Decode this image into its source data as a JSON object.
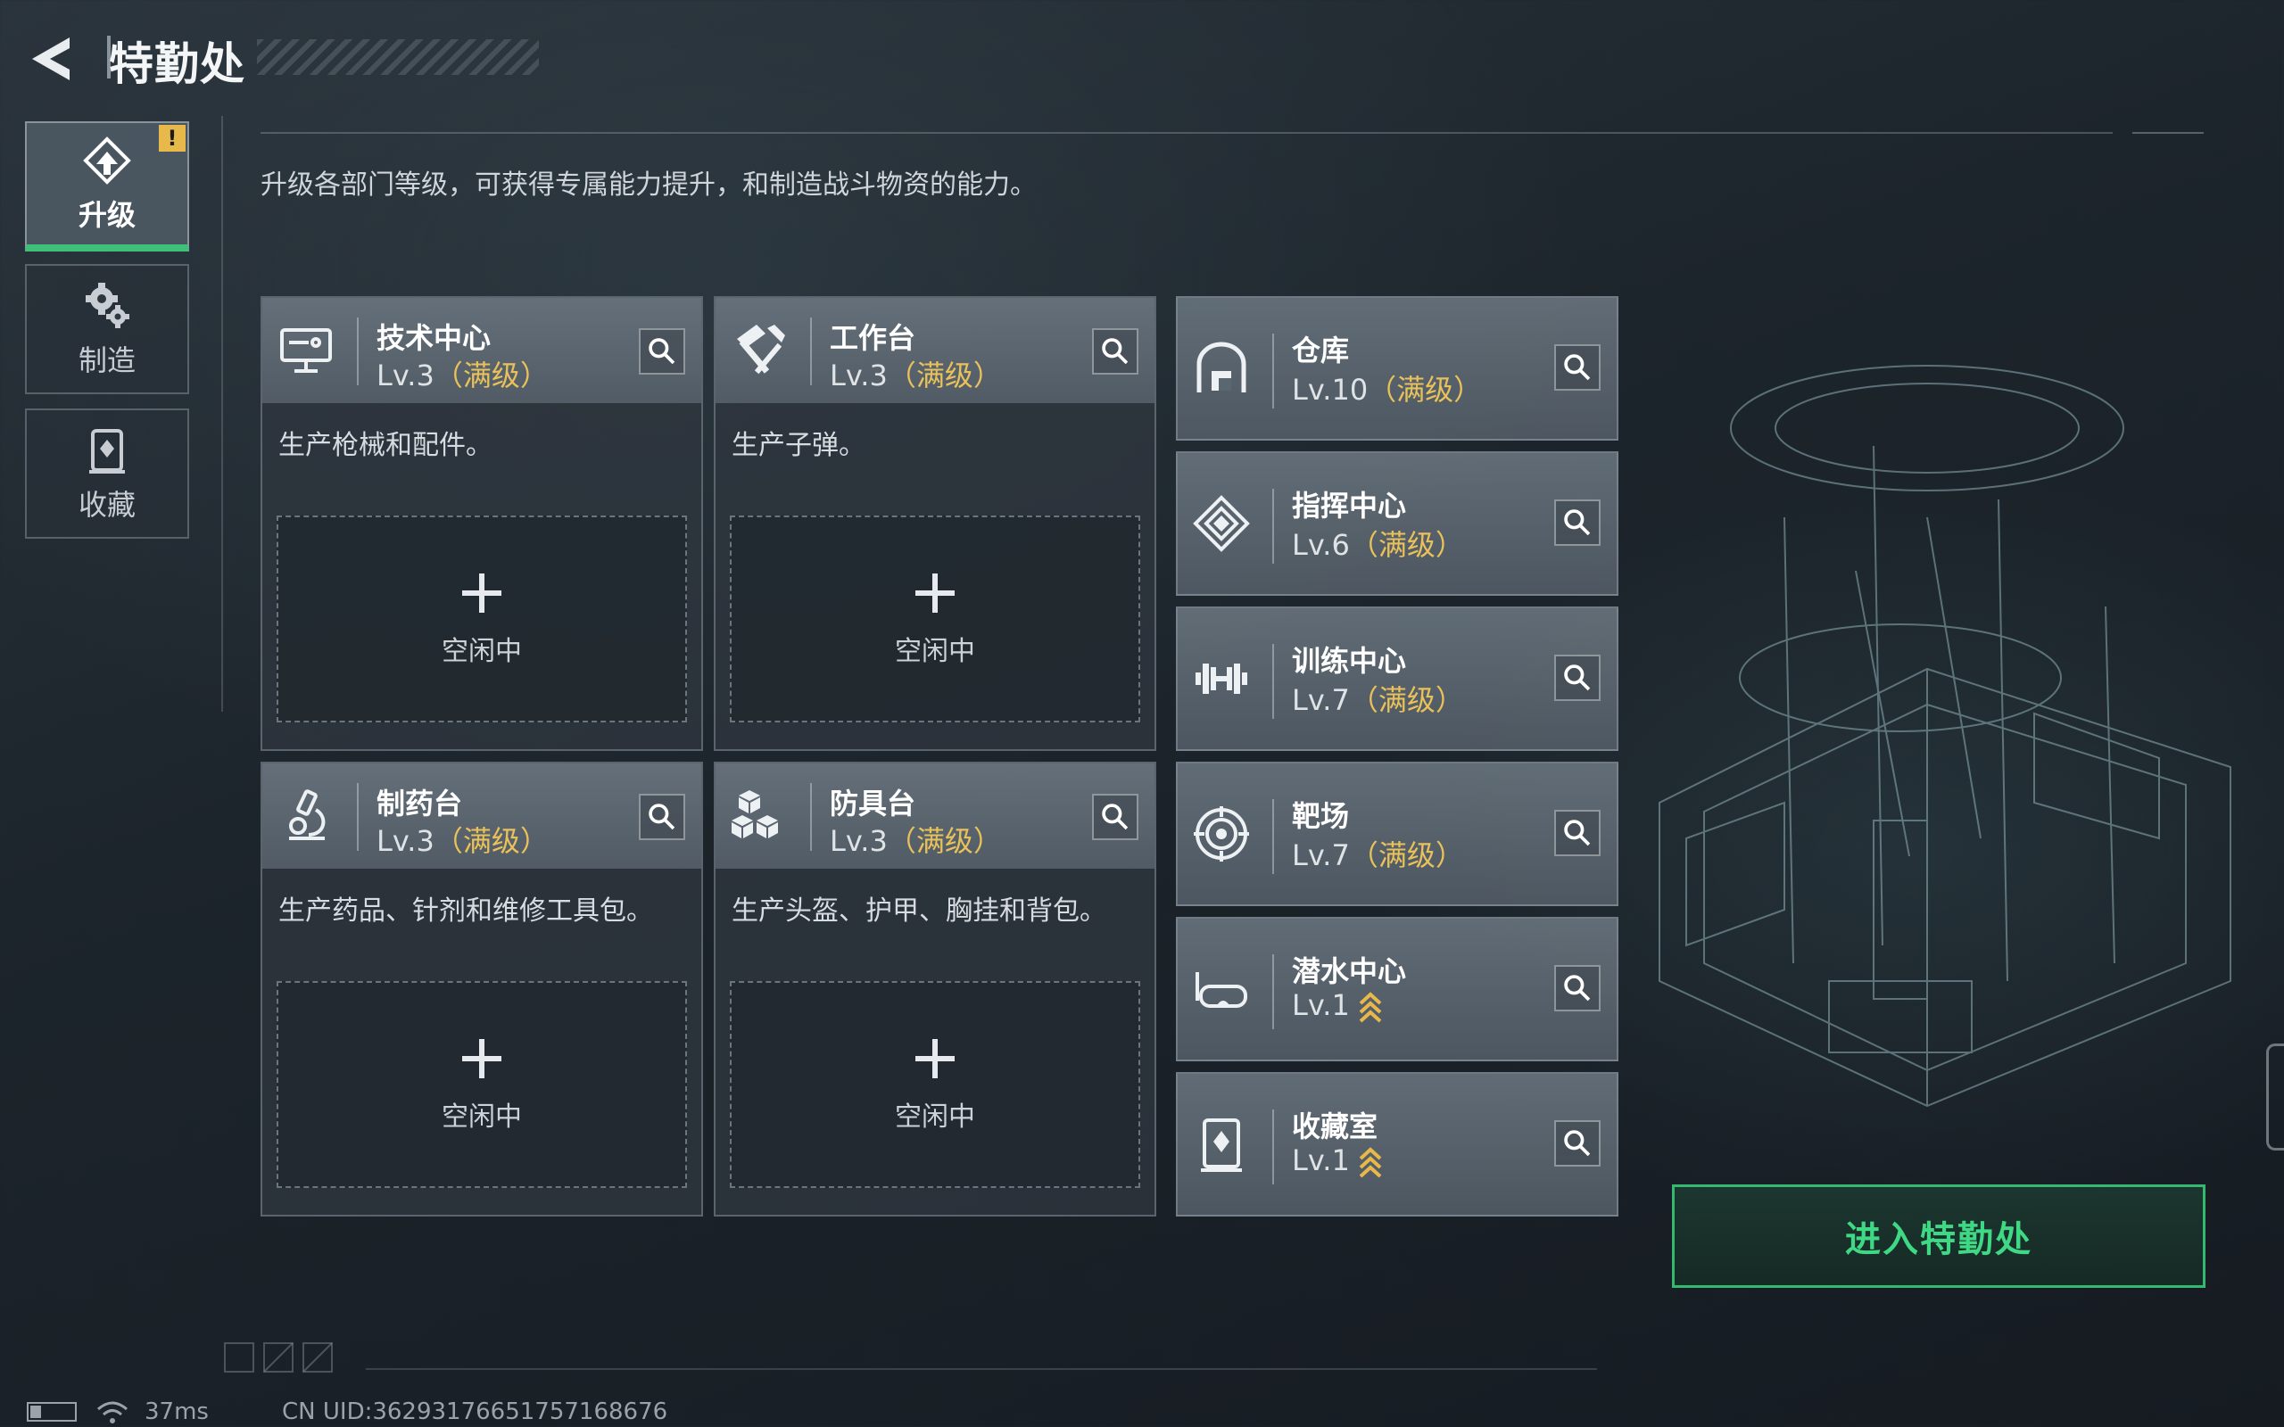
{
  "header": {
    "title": "特勤处"
  },
  "subtitle": "升级各部门等级，可获得专属能力提升，和制造战斗物资的能力。",
  "nav": {
    "badge": "!",
    "items": [
      {
        "label": "升级",
        "icon": "upgrade-icon",
        "active": true
      },
      {
        "label": "制造",
        "icon": "gear-icon",
        "active": false
      },
      {
        "label": "收藏",
        "icon": "collection-icon",
        "active": false
      }
    ]
  },
  "workshops": [
    {
      "name": "技术中心",
      "level": "Lv.3",
      "max_tag": "（满级）",
      "desc": "生产枪械和配件。",
      "slot_label": "空闲中",
      "icon": "tech-center-icon"
    },
    {
      "name": "工作台",
      "level": "Lv.3",
      "max_tag": "（满级）",
      "desc": "生产子弹。",
      "slot_label": "空闲中",
      "icon": "hammer-icon"
    },
    {
      "name": "制药台",
      "level": "Lv.3",
      "max_tag": "（满级）",
      "desc": "生产药品、针剂和维修工具包。",
      "slot_label": "空闲中",
      "icon": "microscope-icon"
    },
    {
      "name": "防具台",
      "level": "Lv.3",
      "max_tag": "（满级）",
      "desc": "生产头盔、护甲、胸挂和背包。",
      "slot_label": "空闲中",
      "icon": "cubes-icon"
    }
  ],
  "facilities": [
    {
      "name": "仓库",
      "level": "Lv.10",
      "max_tag": "（满级）",
      "upgradable": false,
      "icon": "warehouse-icon"
    },
    {
      "name": "指挥中心",
      "level": "Lv.6",
      "max_tag": "（满级）",
      "upgradable": false,
      "icon": "command-center-icon"
    },
    {
      "name": "训练中心",
      "level": "Lv.7",
      "max_tag": "（满级）",
      "upgradable": false,
      "icon": "dumbbell-icon"
    },
    {
      "name": "靶场",
      "level": "Lv.7",
      "max_tag": "（满级）",
      "upgradable": false,
      "icon": "target-icon"
    },
    {
      "name": "潜水中心",
      "level": "Lv.1",
      "max_tag": "",
      "upgradable": true,
      "icon": "diving-mask-icon"
    },
    {
      "name": "收藏室",
      "level": "Lv.1",
      "max_tag": "",
      "upgradable": true,
      "icon": "collection-room-icon"
    }
  ],
  "enter_button": "进入特勤处",
  "status": {
    "ping": "37ms",
    "uid": "CN UID:3629317665175716867​6"
  },
  "colors": {
    "accent_green": "#3ec07a",
    "max_gold": "#e8c15a",
    "upgrade_arrow": "#e8b84a"
  }
}
